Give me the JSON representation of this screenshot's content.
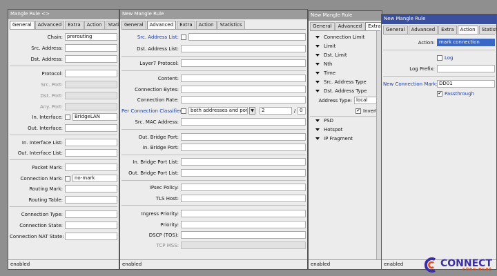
{
  "w1": {
    "title": "Mangle Rule <>",
    "tabs": [
      "General",
      "Advanced",
      "Extra",
      "Action",
      "Statistics"
    ],
    "labels": {
      "chain": "Chain:",
      "src_address": "Src. Address:",
      "dst_address": "Dst. Address:",
      "protocol": "Protocol:",
      "src_port": "Src. Port:",
      "dst_port": "Dst. Port:",
      "any_port": "Any. Port:",
      "in_interface": "In. Interface:",
      "out_interface": "Out. Interface:",
      "in_interface_list": "In. Interface List:",
      "out_interface_list": "Out. Interface List:",
      "packet_mark": "Packet Mark:",
      "connection_mark": "Connection Mark:",
      "routing_mark": "Routing Mark:",
      "routing_table": "Routing Table:",
      "connection_type": "Connection Type:",
      "connection_state": "Connection State:",
      "connection_nat_state": "Connection NAT State:"
    },
    "values": {
      "chain": "prerouting",
      "in_interface": "BridgeLAN",
      "connection_mark": "no-mark"
    },
    "status": "enabled"
  },
  "w2": {
    "title": "New Mangle Rule",
    "tabs": [
      "General",
      "Advanced",
      "Extra",
      "Action",
      "Statistics"
    ],
    "labels": {
      "src_address_list": "Src. Address List:",
      "dst_address_list": "Dst. Address List:",
      "layer7": "Layer7 Protocol:",
      "content": "Content:",
      "connection_bytes": "Connection Bytes:",
      "connection_rate": "Connection Rate:",
      "pcc": "Per Connection Classifier:",
      "src_mac": "Src. MAC Address:",
      "out_bridge_port": "Out. Bridge Port:",
      "in_bridge_port": "In. Bridge Port:",
      "in_bridge_port_list": "In. Bridge Port List:",
      "out_bridge_port_list": "Out. Bridge Port List:",
      "ipsec_policy": "IPsec Policy:",
      "tls_host": "TLS Host:",
      "ingress_priority": "Ingress Priority:",
      "priority": "Priority:",
      "dscp": "DSCP (TOS):",
      "tcp_mss": "TCP MSS:"
    },
    "values": {
      "pcc_mode": "both addresses and ports",
      "pcc_num": "2",
      "pcc_sep": "/",
      "pcc_den": "0"
    },
    "status": "enabled"
  },
  "w3": {
    "title": "New Mangle Rule",
    "tabs": [
      "General",
      "Advanced",
      "Extra"
    ],
    "items": [
      "Connection Limit",
      "Limit",
      "Dst. Limit",
      "Nth",
      "Time",
      "Src. Address Type",
      "Dst. Address Type"
    ],
    "address_type_label": "Address Type:",
    "address_type_value": "local",
    "invert_label": "Invert",
    "items2": [
      "PSD",
      "Hotspot",
      "IP Fragment"
    ],
    "status": "enabled"
  },
  "w4": {
    "title": "New Mangle Rule",
    "tabs": [
      "General",
      "Advanced",
      "Extra",
      "Action",
      "Statistics"
    ],
    "action_label": "Action:",
    "action_value": "mark connection",
    "log_label": "Log",
    "log_prefix_label": "Log Prefix:",
    "new_conn_mark_label": "New Connection Mark:",
    "new_conn_mark_value": "DD01",
    "passthrough_label": "Passthrough",
    "status": "enabled"
  },
  "logo": {
    "main": "CONNECT",
    "sub": "CÔNG NGHỆ"
  },
  "colors": {
    "active_title": "#3a4f9e",
    "inactive_title": "#9b9b9b",
    "link_label": "#1a3fb0",
    "logo": "#3c2ea6"
  }
}
